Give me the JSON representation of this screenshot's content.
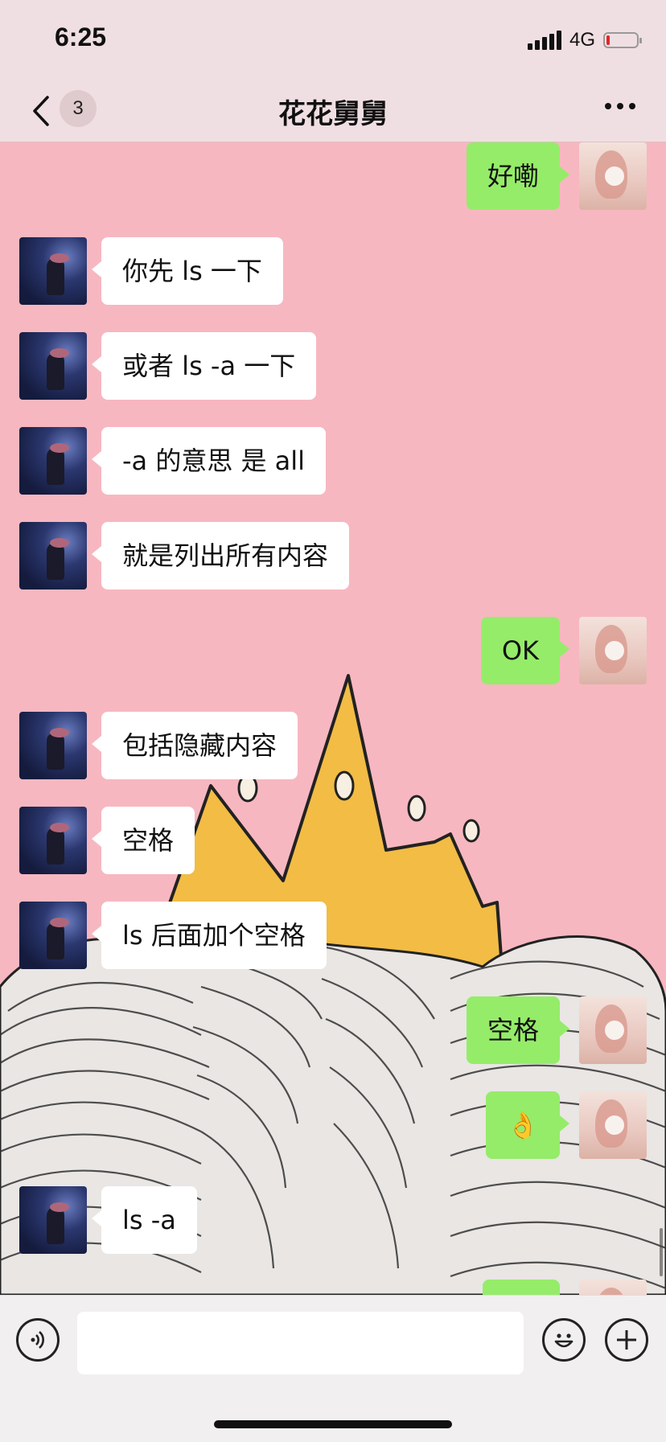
{
  "status_bar": {
    "time": "6:25",
    "network": "4G",
    "battery_level": 0.1
  },
  "nav": {
    "unread_count": "3",
    "title": "花花舅舅"
  },
  "messages": [
    {
      "side": "right",
      "text": "好嘞"
    },
    {
      "side": "left",
      "text": "你先 ls 一下"
    },
    {
      "side": "left",
      "text": "或者 ls -a 一下"
    },
    {
      "side": "left",
      "text": "-a 的意思 是 all"
    },
    {
      "side": "left",
      "text": "就是列出所有内容"
    },
    {
      "side": "right",
      "text": "OK"
    },
    {
      "side": "left",
      "text": "包括隐藏内容"
    },
    {
      "side": "left",
      "text": "空格"
    },
    {
      "side": "left",
      "text": "ls 后面加个空格"
    },
    {
      "side": "right",
      "text": "空格"
    },
    {
      "side": "right",
      "text": "👌"
    },
    {
      "side": "left",
      "text": "ls -a"
    },
    {
      "side": "right",
      "text": ""
    }
  ],
  "input": {
    "value": ""
  },
  "icons": {
    "back": "chevron-left-icon",
    "more": "more-dots-icon",
    "voice": "voice-icon",
    "emoji": "emoji-icon",
    "plus": "plus-icon"
  },
  "colors": {
    "chat_background": "#f7b7c0",
    "own_bubble": "#95ec69",
    "other_bubble": "#ffffff",
    "crown": "#f2bc45",
    "header": "#f0dfe2"
  }
}
